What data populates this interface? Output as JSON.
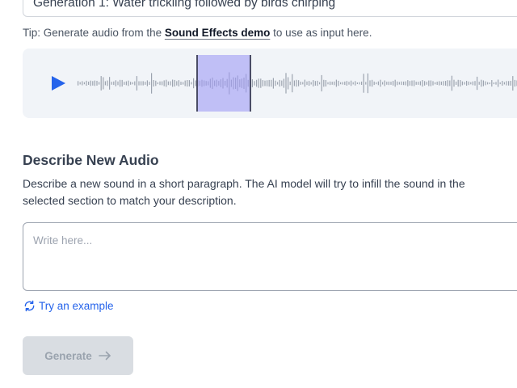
{
  "source": {
    "value": "Generation 1: Water trickling followed by birds chirping"
  },
  "tip": {
    "prefix": "Tip: Generate audio from the ",
    "link": "Sound Effects demo",
    "suffix": " to use as input here."
  },
  "player": {
    "play_icon": "play-icon",
    "accent_color": "#2563eb",
    "selection_color": "#a09bf5"
  },
  "describe": {
    "title": "Describe New Audio",
    "description": "Describe a new sound in a short paragraph. The AI model will try to infill the sound in the selected section to match your description.",
    "placeholder": "Write here...",
    "value": ""
  },
  "example": {
    "label": "Try an example",
    "icon": "refresh-icon"
  },
  "generate": {
    "label": "Generate",
    "icon": "arrow-right-icon",
    "disabled": true
  }
}
